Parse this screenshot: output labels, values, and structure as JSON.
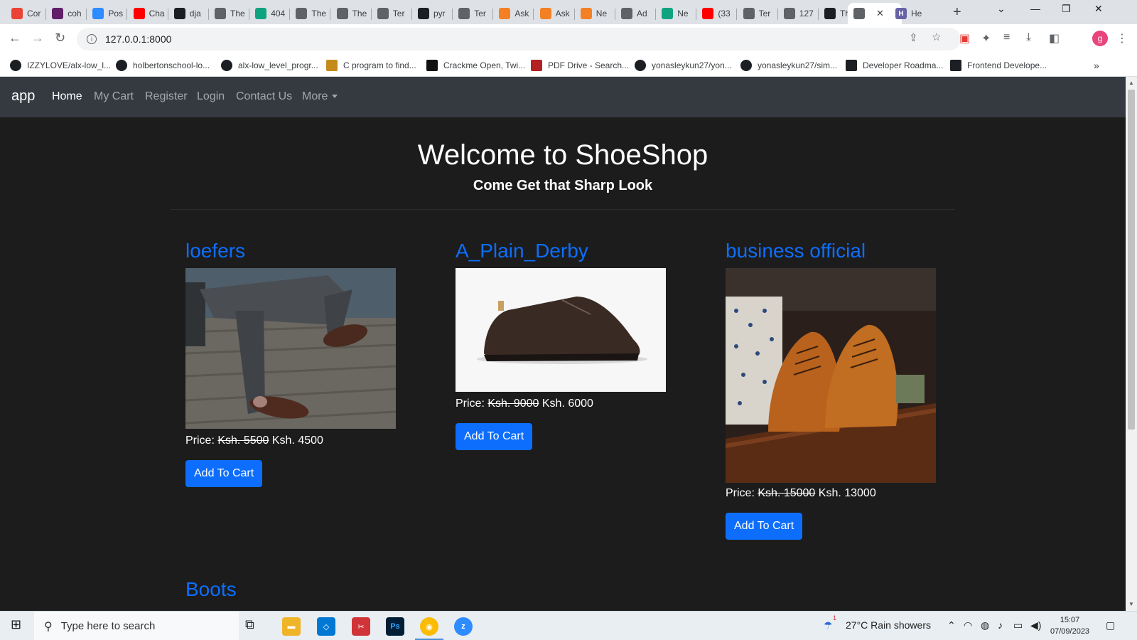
{
  "browser": {
    "tabs": [
      {
        "label": "Cor",
        "favicon": "gmail-icon",
        "color": "#ea4335"
      },
      {
        "label": "coh",
        "favicon": "slack-icon",
        "color": "#611f69"
      },
      {
        "label": "Pos",
        "favicon": "zoom-icon",
        "color": "#2d8cff"
      },
      {
        "label": "Cha",
        "favicon": "youtube-icon",
        "color": "#ff0000"
      },
      {
        "label": "dja",
        "favicon": "github-icon",
        "color": "#1b1f23"
      },
      {
        "label": "The",
        "favicon": "globe-icon",
        "color": "#5f6368"
      },
      {
        "label": "404",
        "favicon": "openai-icon",
        "color": "#10a37f"
      },
      {
        "label": "The",
        "favicon": "globe-icon",
        "color": "#5f6368"
      },
      {
        "label": "The",
        "favicon": "globe-icon",
        "color": "#5f6368"
      },
      {
        "label": "Ter",
        "favicon": "globe-icon",
        "color": "#5f6368"
      },
      {
        "label": "pyr",
        "favicon": "github-icon",
        "color": "#1b1f23"
      },
      {
        "label": "Ter",
        "favicon": "globe-icon",
        "color": "#5f6368"
      },
      {
        "label": "Ask",
        "favicon": "stackoverflow-icon",
        "color": "#f48024"
      },
      {
        "label": "Ask",
        "favicon": "stackoverflow-icon",
        "color": "#f48024"
      },
      {
        "label": "Ne",
        "favicon": "stackoverflow-icon",
        "color": "#f48024"
      },
      {
        "label": "Ad",
        "favicon": "globe-icon",
        "color": "#5f6368"
      },
      {
        "label": "Ne",
        "favicon": "openai-icon",
        "color": "#10a37f"
      },
      {
        "label": "(33",
        "favicon": "youtube-icon",
        "color": "#ff0000"
      },
      {
        "label": "Ter",
        "favicon": "globe-icon",
        "color": "#5f6368"
      },
      {
        "label": "127",
        "favicon": "globe-icon",
        "color": "#5f6368"
      },
      {
        "label": "The",
        "favicon": "person-icon",
        "color": "#1b1f23"
      }
    ],
    "active_tab": {
      "label": "",
      "favicon": "globe-icon"
    },
    "last_tab": {
      "label": "He",
      "favicon": "heroku-icon",
      "color": "#6762a6"
    },
    "new_tab": "+",
    "url": "127.0.0.1:8000",
    "bookmarks": [
      {
        "label": "IZZYLOVE/alx-low_l...",
        "icon": "github-icon"
      },
      {
        "label": "holbertonschool-lo...",
        "icon": "github-icon"
      },
      {
        "label": "alx-low_level_progr...",
        "icon": "github-icon"
      },
      {
        "label": "C program to find...",
        "icon": "bookmark-icon"
      },
      {
        "label": "Crackme Open, Twi...",
        "icon": "bookmark-icon"
      },
      {
        "label": "PDF Drive - Search...",
        "icon": "pdfdrive-icon"
      },
      {
        "label": "yonasleykun27/yon...",
        "icon": "github-icon"
      },
      {
        "label": "yonasleykun27/sim...",
        "icon": "github-icon"
      },
      {
        "label": "Developer Roadma...",
        "icon": "roadmap-icon"
      },
      {
        "label": "Frontend Develope...",
        "icon": "roadmap-icon"
      }
    ],
    "avatar_letter": "g"
  },
  "site": {
    "brand": "app",
    "nav": {
      "home": "Home",
      "cart": "My Cart",
      "register": "Register",
      "login": "Login",
      "contact": "Contact Us",
      "more": "More"
    },
    "hero": {
      "title": "Welcome to ShoeShop",
      "subtitle": "Come Get that Sharp Look"
    },
    "products": [
      {
        "name": "loefers",
        "price_label": "Price:",
        "old_price": "Ksh. 5500",
        "new_price": "Ksh. 4500",
        "button": "Add To Cart"
      },
      {
        "name": "A_Plain_Derby",
        "price_label": "Price:",
        "old_price": "Ksh. 9000",
        "new_price": "Ksh. 6000",
        "button": "Add To Cart"
      },
      {
        "name": "business official",
        "price_label": "Price:",
        "old_price": "Ksh. 15000",
        "new_price": "Ksh. 13000",
        "button": "Add To Cart"
      }
    ],
    "next_section": "Boots",
    "colors": {
      "navbar": "#343a40",
      "accent": "#0d6efd",
      "page_bg": "#1c1c1c"
    }
  },
  "taskbar": {
    "search_placeholder": "Type here to search",
    "weather": "27°C  Rain showers",
    "weather_badge": "1",
    "time": "15:07",
    "date": "07/09/2023",
    "apps": [
      "task-view-icon",
      "file-explorer-icon",
      "vscode-icon",
      "snipping-tool-icon",
      "photoshop-icon",
      "chrome-icon",
      "zoom-icon"
    ]
  }
}
